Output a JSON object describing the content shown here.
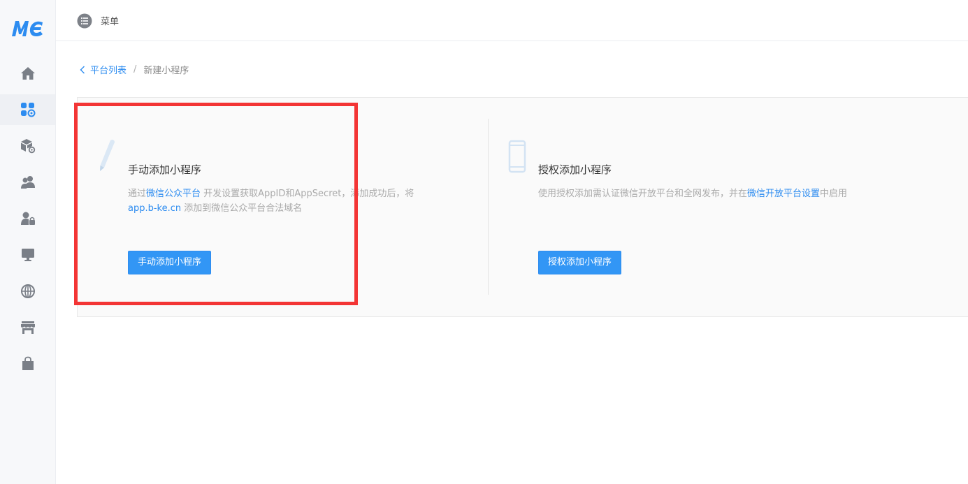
{
  "sidebar": {
    "logo_text": "MC",
    "items": [
      {
        "icon": "home-icon"
      },
      {
        "icon": "apps-settings-icon",
        "active": true
      },
      {
        "icon": "package-settings-icon"
      },
      {
        "icon": "users-icon"
      },
      {
        "icon": "user-lock-icon"
      },
      {
        "icon": "monitor-icon"
      },
      {
        "icon": "globe-icon"
      },
      {
        "icon": "store-icon"
      },
      {
        "icon": "shopping-bag-icon"
      }
    ]
  },
  "topbar": {
    "menu_icon": "list-icon",
    "menu_label": "菜单"
  },
  "breadcrumb": {
    "back_label": "平台列表",
    "separator": "/",
    "current": "新建小程序"
  },
  "cards": {
    "manual": {
      "icon": "pencil-icon",
      "title": "手动添加小程序",
      "desc_prefix": "通过",
      "desc_link": "微信公众平台",
      "desc_middle": " 开发设置获取AppID和AppSecret，添加成功后，将",
      "desc_domain": "app.b-ke.cn",
      "desc_suffix": " 添加到微信公众平台合法域名",
      "button_label": "手动添加小程序"
    },
    "authorize": {
      "icon": "phone-icon",
      "title": "授权添加小程序",
      "desc_prefix": "使用授权添加需认证微信开放平台和全网发布，并在",
      "desc_link": "微信开放平台设置",
      "desc_suffix": "中启用",
      "button_label": "授权添加小程序"
    }
  },
  "colors": {
    "accent": "#2d8cf0",
    "button": "#3296f5",
    "highlight": "#f33535",
    "icon_gray": "#7a7f87"
  }
}
